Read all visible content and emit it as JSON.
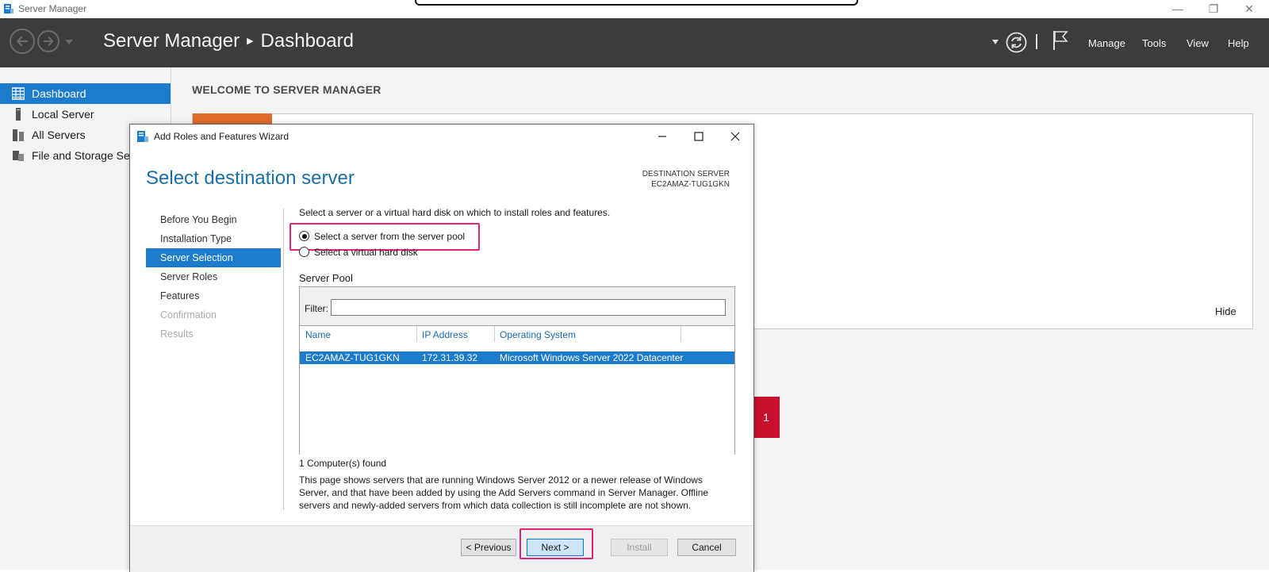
{
  "window": {
    "title": "Server Manager",
    "controls": {
      "minimize": "—",
      "restore": "❐",
      "close": "✕"
    }
  },
  "header": {
    "app": "Server Manager",
    "separator": "▶",
    "page": "Dashboard",
    "menus": [
      "Manage",
      "Tools",
      "View",
      "Help"
    ]
  },
  "sidebar": {
    "items": [
      {
        "label": "Dashboard",
        "icon": "dashboard-grid-icon",
        "active": true
      },
      {
        "label": "Local Server",
        "icon": "server-icon"
      },
      {
        "label": "All Servers",
        "icon": "servers-icon"
      },
      {
        "label": "File and Storage Ser",
        "icon": "storage-icon"
      }
    ]
  },
  "main": {
    "welcome": "WELCOME TO SERVER MANAGER",
    "hide": "Hide",
    "red_tile_count": "1"
  },
  "wizard": {
    "title": "Add Roles and Features Wizard",
    "page_title": "Select destination server",
    "destination_label": "DESTINATION SERVER",
    "destination_value": "EC2AMAZ-TUG1GKN",
    "steps": [
      {
        "label": "Before You Begin",
        "state": "normal"
      },
      {
        "label": "Installation Type",
        "state": "normal"
      },
      {
        "label": "Server Selection",
        "state": "current"
      },
      {
        "label": "Server Roles",
        "state": "normal"
      },
      {
        "label": "Features",
        "state": "normal"
      },
      {
        "label": "Confirmation",
        "state": "disabled"
      },
      {
        "label": "Results",
        "state": "disabled"
      }
    ],
    "intro": "Select a server or a virtual hard disk on which to install roles and features.",
    "option_pool": "Select a server from the server pool",
    "option_vhd": "Select a virtual hard disk",
    "pool_title": "Server Pool",
    "filter_label": "Filter:",
    "filter_value": "",
    "columns": [
      "Name",
      "IP Address",
      "Operating System"
    ],
    "rows": [
      {
        "name": "EC2AMAZ-TUG1GKN",
        "ip": "172.31.39.32",
        "os": "Microsoft Windows Server 2022 Datacenter"
      }
    ],
    "found": "1 Computer(s) found",
    "description": "This page shows servers that are running Windows Server 2012 or a newer release of Windows Server, and that have been added by using the Add Servers command in Server Manager. Offline servers and newly-added servers from which data collection is still incomplete are not shown.",
    "buttons": {
      "previous": "< Previous",
      "next": "Next >",
      "install": "Install",
      "cancel": "Cancel"
    }
  },
  "colors": {
    "header_bg": "#3c3c3c",
    "accent": "#1c7ccb",
    "highlight": "#e2237a",
    "tile_orange": "#e06a2c",
    "tile_red": "#c8102e"
  }
}
